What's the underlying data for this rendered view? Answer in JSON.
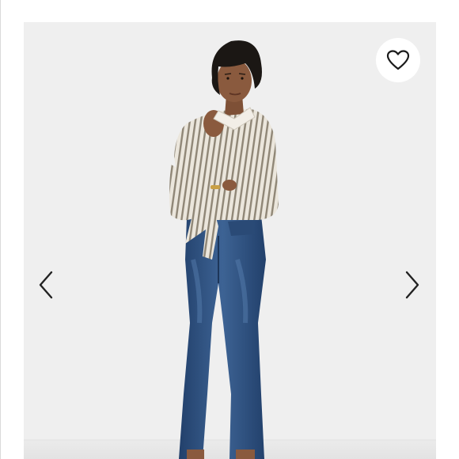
{
  "listing": {
    "photo": {
      "subject": "model-photo",
      "accent_colors": {
        "backdrop": "#efefef",
        "shirt": "#e9e4da",
        "shirt_stripe": "#8b8273",
        "denim": "#2f4f7c",
        "hair": "#1b1714",
        "skin": "#8a5a3e"
      }
    },
    "like_button": {
      "icon": "heart-outline-icon",
      "color": "#1a1a1a"
    },
    "prev_button": {
      "icon": "chevron-left-icon",
      "color": "#222222"
    },
    "next_button": {
      "icon": "chevron-right-icon",
      "color": "#222222"
    }
  }
}
